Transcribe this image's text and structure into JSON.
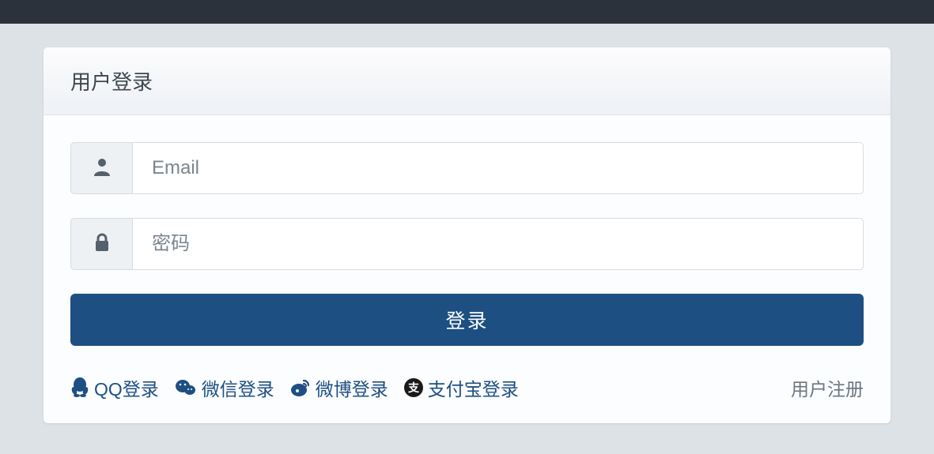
{
  "header": {
    "title": "用户登录"
  },
  "form": {
    "email_placeholder": "Email",
    "password_placeholder": "密码",
    "submit_label": "登录"
  },
  "social": {
    "qq": "QQ登录",
    "wechat": "微信登录",
    "weibo": "微博登录",
    "alipay": "支付宝登录"
  },
  "register_label": "用户注册"
}
